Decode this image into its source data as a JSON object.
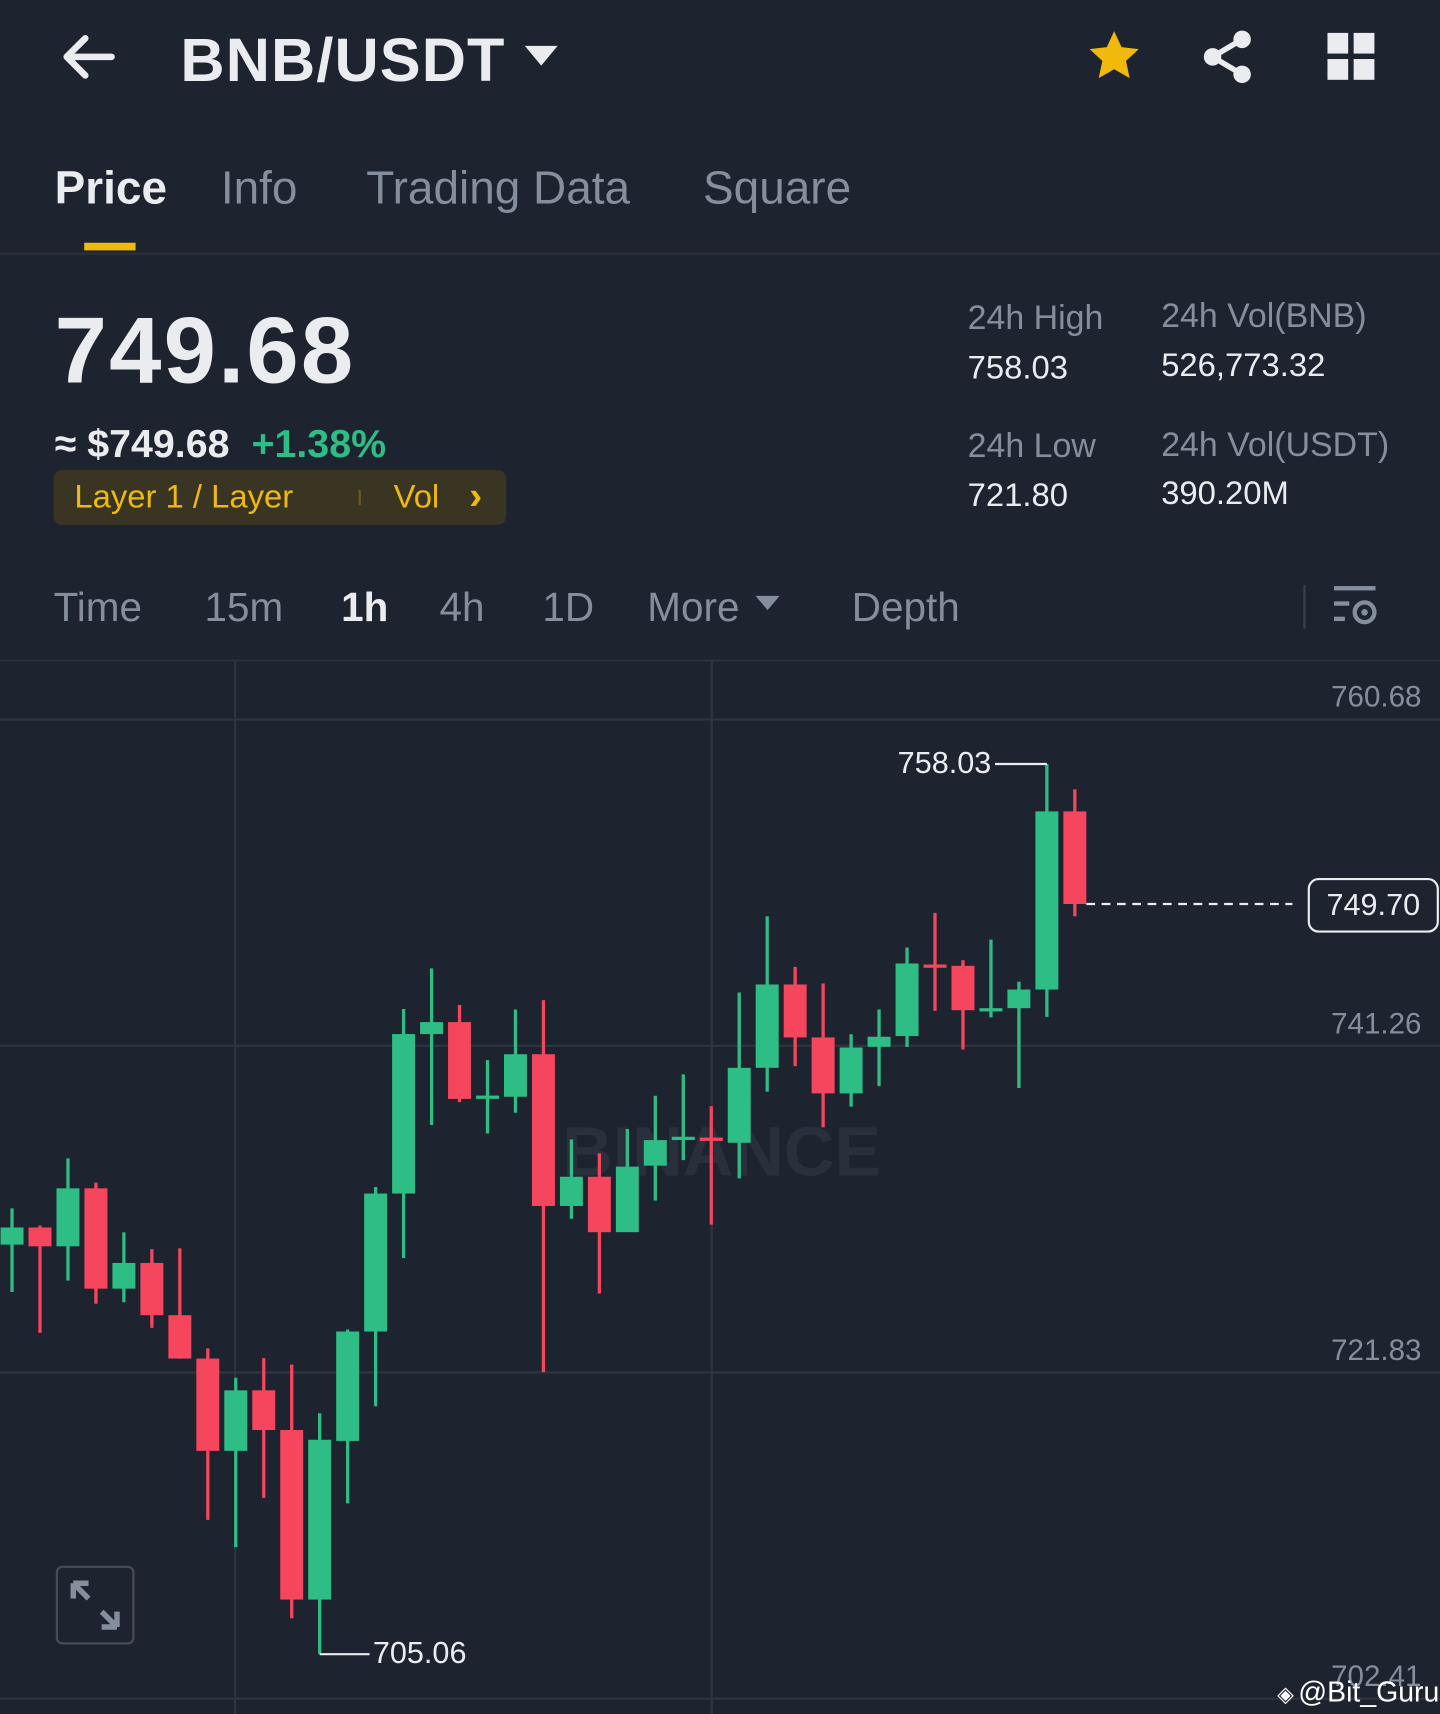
{
  "header": {
    "title": "BNB/USDT",
    "back_icon": "arrow-left-icon",
    "dropdown_icon": "caret-down-icon",
    "favorite_icon": "star-icon",
    "share_icon": "share-icon",
    "menu_icon": "grid-icon",
    "accent": "#f0b90b"
  },
  "tabs": [
    {
      "label": "Price",
      "active": true
    },
    {
      "label": "Info"
    },
    {
      "label": "Trading Data"
    },
    {
      "label": "Square"
    }
  ],
  "ticker": {
    "last_price": "749.68",
    "fiat_price": "≈ $749.68",
    "change": "+1.38%",
    "tag": "Layer 1 / Layer",
    "tag_vol": "Vol",
    "tag_chevron": "›"
  },
  "stats": {
    "high_label": "24h High",
    "high": "758.03",
    "low_label": "24h Low",
    "low": "721.80",
    "vol_base_label": "24h Vol(BNB)",
    "vol_base": "526,773.32",
    "vol_quote_label": "24h Vol(USDT)",
    "vol_quote": "390.20M"
  },
  "timeframes": {
    "time": "Time",
    "m15": "15m",
    "h1": "1h",
    "h4": "4h",
    "d1": "1D",
    "more": "More",
    "depth": "Depth",
    "active": "1h"
  },
  "watermark": "BINANCE",
  "credit": "@Bit_Guru",
  "colors": {
    "up": "#2ebd85",
    "down": "#f6465d"
  },
  "chart_data": {
    "type": "candlestick",
    "interval": "1h",
    "y_ticks": [
      "760.68",
      "741.26",
      "721.83",
      "702.41"
    ],
    "ylim": [
      702.41,
      760.68
    ],
    "high_label": "758.03",
    "low_label": "705.06",
    "current_price_label": "749.70",
    "current_price": 749.7,
    "candles": [
      [
        729.43,
        731.59,
        726.61,
        730.45
      ],
      [
        730.45,
        730.57,
        724.18,
        729.33
      ],
      [
        729.33,
        734.56,
        727.29,
        732.78
      ],
      [
        732.78,
        733.12,
        725.91,
        726.81
      ],
      [
        726.81,
        730.16,
        726.0,
        728.34
      ],
      [
        728.34,
        729.16,
        724.48,
        725.23
      ],
      [
        725.23,
        729.21,
        722.65,
        722.65
      ],
      [
        722.65,
        723.26,
        713.05,
        717.16
      ],
      [
        717.16,
        721.51,
        711.43,
        720.76
      ],
      [
        720.76,
        722.68,
        714.36,
        718.4
      ],
      [
        718.4,
        722.29,
        707.2,
        708.31
      ],
      [
        708.31,
        719.4,
        705.06,
        717.82
      ],
      [
        717.75,
        724.38,
        714.03,
        724.26
      ],
      [
        724.26,
        732.86,
        719.81,
        732.47
      ],
      [
        732.47,
        743.45,
        728.63,
        741.96
      ],
      [
        741.96,
        745.87,
        736.55,
        742.67
      ],
      [
        742.67,
        743.69,
        737.91,
        738.1
      ],
      [
        738.2,
        740.41,
        736.04,
        738.3
      ],
      [
        738.23,
        743.42,
        737.28,
        740.76
      ],
      [
        740.76,
        743.98,
        721.84,
        731.73
      ],
      [
        731.73,
        735.69,
        730.97,
        733.47
      ],
      [
        733.47,
        734.86,
        726.52,
        730.17
      ],
      [
        730.17,
        736.31,
        730.78,
        734.07
      ],
      [
        734.13,
        738.29,
        732.05,
        735.65
      ],
      [
        735.7,
        739.56,
        734.46,
        735.85
      ],
      [
        735.8,
        737.67,
        730.62,
        735.6
      ],
      [
        735.49,
        744.43,
        733.37,
        739.95
      ],
      [
        739.95,
        748.97,
        738.53,
        744.91
      ],
      [
        744.91,
        745.96,
        740.05,
        741.76
      ],
      [
        741.76,
        744.97,
        736.41,
        738.43
      ],
      [
        738.43,
        741.95,
        737.64,
        741.16
      ],
      [
        741.2,
        743.42,
        738.86,
        741.8
      ],
      [
        741.84,
        747.11,
        741.2,
        746.16
      ],
      [
        746.1,
        749.17,
        743.34,
        746.0
      ],
      [
        746.02,
        746.35,
        741.04,
        743.38
      ],
      [
        743.45,
        747.58,
        742.95,
        743.5
      ],
      [
        743.5,
        745.07,
        738.75,
        744.61
      ],
      [
        744.61,
        758.03,
        742.98,
        755.21
      ],
      [
        755.21,
        756.52,
        748.97,
        749.7
      ]
    ]
  }
}
